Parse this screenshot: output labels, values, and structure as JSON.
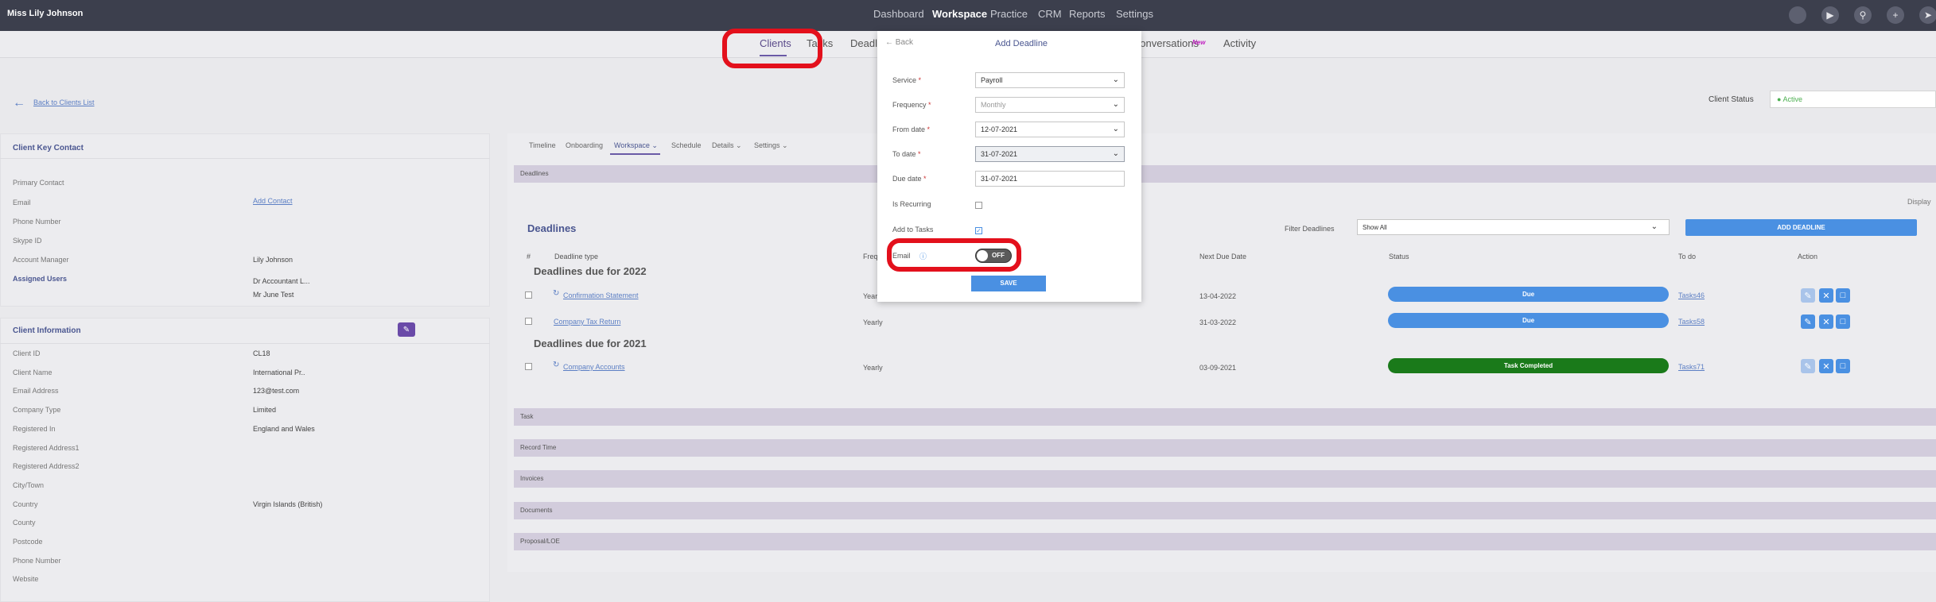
{
  "topbar": {
    "user": "Miss Lily Johnson",
    "nav": [
      "Dashboard",
      "Workspace",
      "Practice",
      "CRM",
      "Reports",
      "Settings"
    ],
    "active": "Workspace",
    "icons": [
      "avatar-icon",
      "megaphone-icon",
      "search-icon",
      "plus-icon",
      "rocket-icon"
    ]
  },
  "subnav": {
    "tabs": [
      "Clients",
      "Tasks",
      "Deadli",
      "Conversations",
      "Activity"
    ],
    "new_badge": "New"
  },
  "back_link": "Back to Clients List",
  "client_status": {
    "label": "Client Status",
    "value": "Active"
  },
  "key_contact": {
    "title": "Client Key Contact",
    "rows": [
      {
        "label": "Primary Contact",
        "value": ""
      },
      {
        "label": "Email",
        "value": "Add Contact"
      },
      {
        "label": "Phone Number",
        "value": ""
      },
      {
        "label": "Skype ID",
        "value": ""
      },
      {
        "label": "Account Manager",
        "value": "Lily Johnson"
      }
    ],
    "assigned_label": "Assigned Users",
    "assigned_users": [
      "Dr Accountant L...",
      "Mr June Test"
    ]
  },
  "client_info": {
    "title": "Client Information",
    "rows": [
      {
        "label": "Client ID",
        "value": "CL18"
      },
      {
        "label": "Client Name",
        "value": "International Pr.."
      },
      {
        "label": "Email Address",
        "value": "123@test.com"
      },
      {
        "label": "Company Type",
        "value": "Limited"
      },
      {
        "label": "Registered In",
        "value": "England and Wales"
      },
      {
        "label": "Registered Address1",
        "value": ""
      },
      {
        "label": "Registered Address2",
        "value": ""
      },
      {
        "label": "City/Town",
        "value": ""
      },
      {
        "label": "Country",
        "value": "Virgin Islands (British)"
      },
      {
        "label": "County",
        "value": ""
      },
      {
        "label": "Postcode",
        "value": ""
      },
      {
        "label": "Phone Number",
        "value": ""
      },
      {
        "label": "Website",
        "value": ""
      }
    ]
  },
  "workspace_tabs": [
    "Timeline",
    "Onboarding",
    "Workspace",
    "Schedule",
    "Details",
    "Settings"
  ],
  "deadlines_band": "Deadlines",
  "deadlines": {
    "title": "Deadlines",
    "display_label": "Display",
    "filter_label": "Filter Deadlines",
    "filter_value": "Show All",
    "add_button": "ADD DEADLINE",
    "columns": [
      "#",
      "Deadline type",
      "Frequ",
      "Next Due Date",
      "Status",
      "To do",
      "Action"
    ],
    "groups": [
      {
        "title": "Deadlines due for 2022",
        "rows": [
          {
            "type": "Confirmation Statement",
            "freq": "Year",
            "due": "13-04-2022",
            "status": "Due",
            "todo": "Tasks46",
            "recurring": true
          },
          {
            "type": "Company Tax Return",
            "freq": "Yearly",
            "due": "31-03-2022",
            "status": "Due",
            "todo": "Tasks58",
            "recurring": false
          }
        ]
      },
      {
        "title": "Deadlines due for 2021",
        "rows": [
          {
            "type": "Company Accounts",
            "freq": "Yearly",
            "due": "03-09-2021",
            "status": "Task Completed",
            "todo": "Tasks71",
            "recurring": true
          }
        ]
      }
    ]
  },
  "bands": [
    "Task",
    "Record Time",
    "Invoices",
    "Documents",
    "Proposal/LOE"
  ],
  "modal": {
    "back": "Back",
    "title": "Add Deadline",
    "service_label": "Service",
    "service_value": "Payroll",
    "frequency_label": "Frequency",
    "frequency_value": "Monthly",
    "from_label": "From date",
    "from_value": "12-07-2021",
    "to_label": "To date",
    "to_value": "31-07-2021",
    "due_label": "Due date",
    "due_value": "31-07-2021",
    "recurring_label": "Is Recurring",
    "add_tasks_label": "Add to Tasks",
    "email_label": "Email",
    "toggle_text": "OFF",
    "save": "SAVE"
  },
  "colors": {
    "topbar": "#3c3f4d",
    "due": "#4a90e2",
    "completed": "#1a7a1a",
    "accent": "#6a5aa6",
    "highlight": "#e3101c"
  }
}
